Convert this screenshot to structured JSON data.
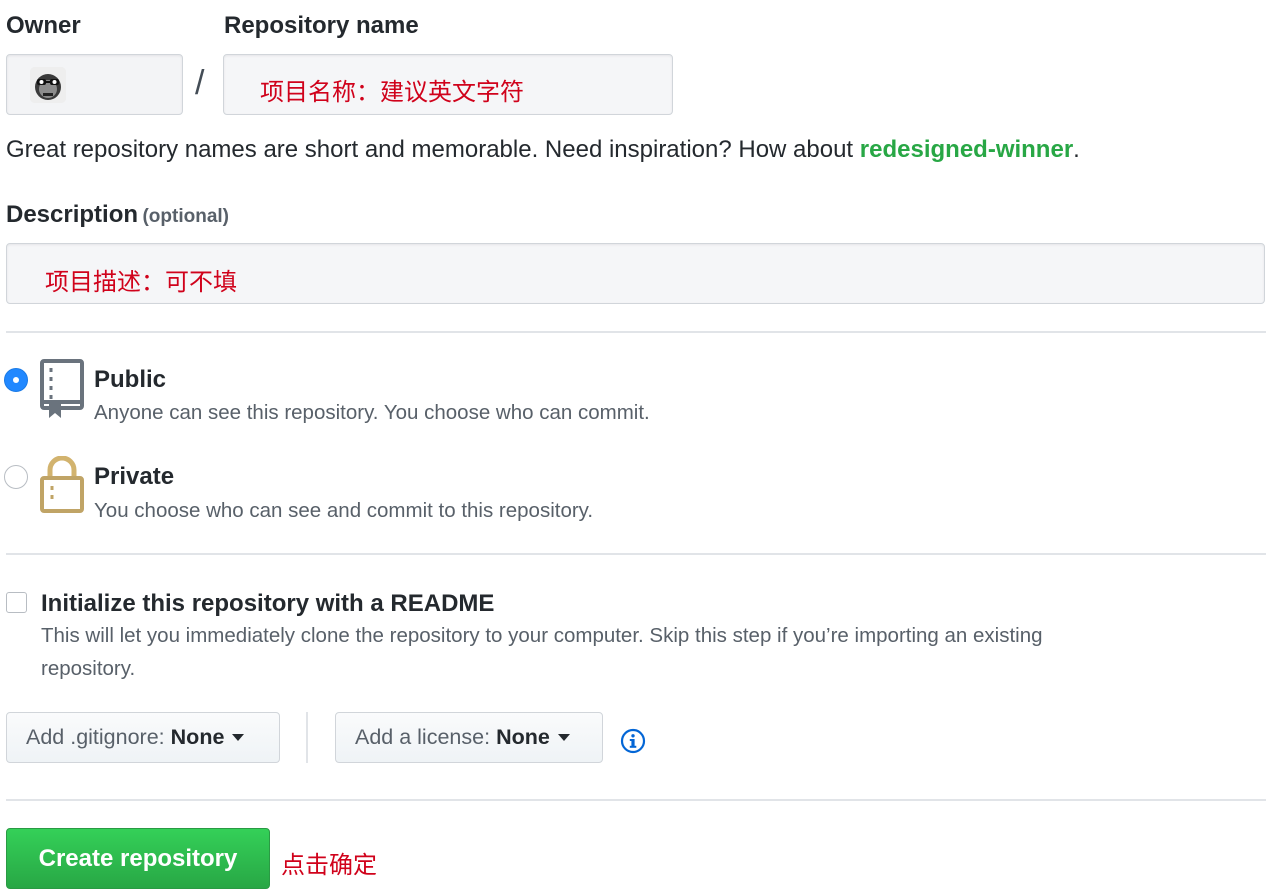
{
  "owner": {
    "label": "Owner",
    "avatar_alt": "owner-avatar"
  },
  "repo_name": {
    "label": "Repository name",
    "separator": "/",
    "annotation": "项目名称：建议英文字符"
  },
  "hint": {
    "text": "Great repository names are short and memorable. Need inspiration? How about ",
    "suggestion": "redesigned-winner",
    "period": "."
  },
  "description": {
    "label": "Description",
    "optional": "(optional)",
    "annotation": "项目描述：可不填"
  },
  "visibility": {
    "public": {
      "title": "Public",
      "desc": "Anyone can see this repository. You choose who can commit.",
      "checked": true
    },
    "private": {
      "title": "Private",
      "desc": "You choose who can see and commit to this repository.",
      "checked": false
    }
  },
  "readme": {
    "title": "Initialize this repository with a README",
    "desc_line1": "This will let you immediately clone the repository to your computer. Skip this step if you’re importing an existing",
    "desc_line2": "repository."
  },
  "gitignore": {
    "prefix": "Add .gitignore:",
    "value": "None"
  },
  "license": {
    "prefix": "Add a license:",
    "value": "None"
  },
  "submit": {
    "label": "Create repository",
    "annotation": "点击确定"
  },
  "colors": {
    "accent_green": "#2ea44f",
    "suggestion_green": "#28a745",
    "radio_blue": "#2188ff",
    "annotation_red": "#d0021b",
    "info_blue": "#0366d6"
  }
}
